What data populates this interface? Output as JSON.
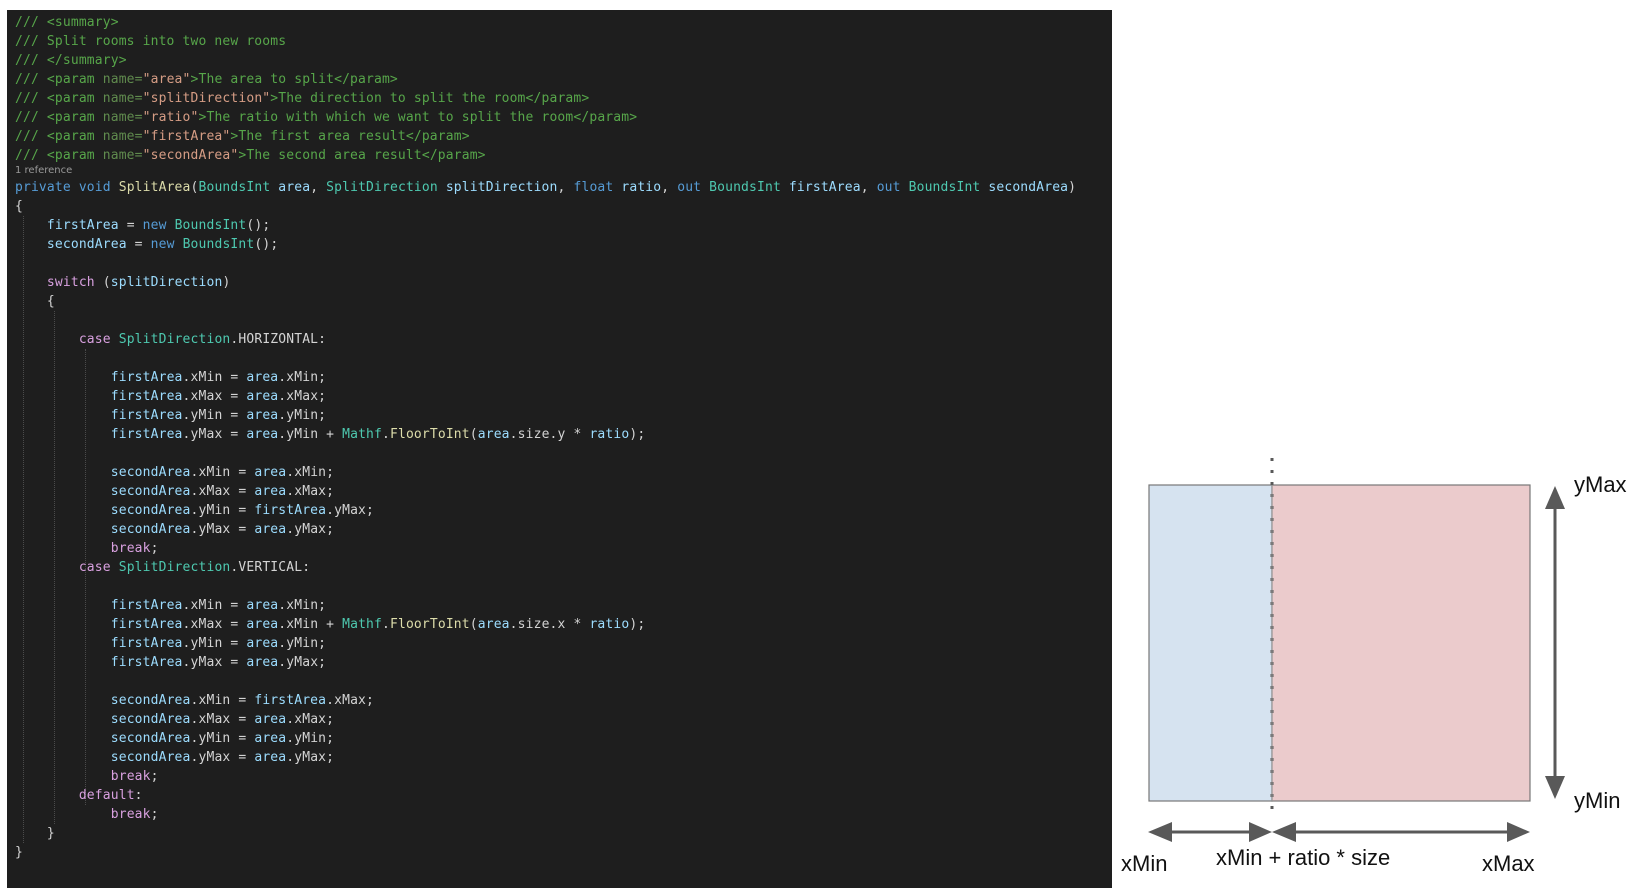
{
  "colors": {
    "editor_bg": "#1e1e1e",
    "comment": "#57a64a",
    "doc_tag": "#608b4e",
    "doc_string": "#d69d85",
    "keyword": "#569cd6",
    "control_keyword": "#d8a0df",
    "type": "#4ec9b0",
    "method": "#dcdcaa",
    "variable": "#9cdcfe",
    "parameter": "#9cdcfe",
    "plain": "#d4d4d4",
    "codelens": "#999999",
    "first_area_fill": "#d6e3f0",
    "second_area_fill": "#ebcbcc",
    "arrow": "#595959"
  },
  "code": {
    "reference_codelens": "1 reference",
    "lines": [
      [
        [
          "/// <summary>",
          "comment"
        ]
      ],
      [
        [
          "/// Split rooms into two new rooms",
          "comment"
        ]
      ],
      [
        [
          "/// </summary>",
          "comment"
        ]
      ],
      [
        [
          "/// <param ",
          "comment"
        ],
        [
          "name=",
          "doc_tag"
        ],
        [
          "\"area\"",
          "doc_string"
        ],
        [
          ">The area to split</param>",
          "comment"
        ]
      ],
      [
        [
          "/// <param ",
          "comment"
        ],
        [
          "name=",
          "doc_tag"
        ],
        [
          "\"splitDirection\"",
          "doc_string"
        ],
        [
          ">The direction to split the room</param>",
          "comment"
        ]
      ],
      [
        [
          "/// <param ",
          "comment"
        ],
        [
          "name=",
          "doc_tag"
        ],
        [
          "\"ratio\"",
          "doc_string"
        ],
        [
          ">The ratio with which we want to split the room</param>",
          "comment"
        ]
      ],
      [
        [
          "/// <param ",
          "comment"
        ],
        [
          "name=",
          "doc_tag"
        ],
        [
          "\"firstArea\"",
          "doc_string"
        ],
        [
          ">The first area result</param>",
          "comment"
        ]
      ],
      [
        [
          "/// <param ",
          "comment"
        ],
        [
          "name=",
          "doc_tag"
        ],
        [
          "\"secondArea\"",
          "doc_string"
        ],
        [
          ">The second area result</param>",
          "comment"
        ]
      ],
      [
        [
          "private ",
          "keyword"
        ],
        [
          "void ",
          "keyword"
        ],
        [
          "SplitArea",
          "method"
        ],
        [
          "(",
          "plain"
        ],
        [
          "BoundsInt ",
          "type"
        ],
        [
          "area",
          "parameter"
        ],
        [
          ", ",
          "plain"
        ],
        [
          "SplitDirection ",
          "type"
        ],
        [
          "splitDirection",
          "parameter"
        ],
        [
          ", ",
          "plain"
        ],
        [
          "float ",
          "keyword"
        ],
        [
          "ratio",
          "parameter"
        ],
        [
          ", ",
          "plain"
        ],
        [
          "out ",
          "keyword"
        ],
        [
          "BoundsInt ",
          "type"
        ],
        [
          "firstArea",
          "parameter"
        ],
        [
          ", ",
          "plain"
        ],
        [
          "out ",
          "keyword"
        ],
        [
          "BoundsInt ",
          "type"
        ],
        [
          "secondArea",
          "parameter"
        ],
        [
          ")",
          "plain"
        ]
      ],
      [
        [
          "{",
          "plain"
        ]
      ],
      [
        [
          "    ",
          "plain"
        ],
        [
          "firstArea",
          "variable"
        ],
        [
          " = ",
          "plain"
        ],
        [
          "new ",
          "keyword"
        ],
        [
          "BoundsInt",
          "type"
        ],
        [
          "();",
          "plain"
        ]
      ],
      [
        [
          "    ",
          "plain"
        ],
        [
          "secondArea",
          "variable"
        ],
        [
          " = ",
          "plain"
        ],
        [
          "new ",
          "keyword"
        ],
        [
          "BoundsInt",
          "type"
        ],
        [
          "();",
          "plain"
        ]
      ],
      [],
      [
        [
          "    ",
          "plain"
        ],
        [
          "switch ",
          "control_keyword"
        ],
        [
          "(",
          "plain"
        ],
        [
          "splitDirection",
          "variable"
        ],
        [
          ")",
          "plain"
        ]
      ],
      [
        [
          "    {",
          "plain"
        ]
      ],
      [],
      [
        [
          "        ",
          "plain"
        ],
        [
          "case ",
          "control_keyword"
        ],
        [
          "SplitDirection",
          "type"
        ],
        [
          ".HORIZONTAL:",
          "plain"
        ]
      ],
      [],
      [
        [
          "            ",
          "plain"
        ],
        [
          "firstArea",
          "variable"
        ],
        [
          ".xMin = ",
          "plain"
        ],
        [
          "area",
          "variable"
        ],
        [
          ".xMin;",
          "plain"
        ]
      ],
      [
        [
          "            ",
          "plain"
        ],
        [
          "firstArea",
          "variable"
        ],
        [
          ".xMax = ",
          "plain"
        ],
        [
          "area",
          "variable"
        ],
        [
          ".xMax;",
          "plain"
        ]
      ],
      [
        [
          "            ",
          "plain"
        ],
        [
          "firstArea",
          "variable"
        ],
        [
          ".yMin = ",
          "plain"
        ],
        [
          "area",
          "variable"
        ],
        [
          ".yMin;",
          "plain"
        ]
      ],
      [
        [
          "            ",
          "plain"
        ],
        [
          "firstArea",
          "variable"
        ],
        [
          ".yMax = ",
          "plain"
        ],
        [
          "area",
          "variable"
        ],
        [
          ".yMin + ",
          "plain"
        ],
        [
          "Mathf",
          "type"
        ],
        [
          ".",
          "plain"
        ],
        [
          "FloorToInt",
          "method"
        ],
        [
          "(",
          "plain"
        ],
        [
          "area",
          "variable"
        ],
        [
          ".size.y * ",
          "plain"
        ],
        [
          "ratio",
          "variable"
        ],
        [
          ");",
          "plain"
        ]
      ],
      [],
      [
        [
          "            ",
          "plain"
        ],
        [
          "secondArea",
          "variable"
        ],
        [
          ".xMin = ",
          "plain"
        ],
        [
          "area",
          "variable"
        ],
        [
          ".xMin;",
          "plain"
        ]
      ],
      [
        [
          "            ",
          "plain"
        ],
        [
          "secondArea",
          "variable"
        ],
        [
          ".xMax = ",
          "plain"
        ],
        [
          "area",
          "variable"
        ],
        [
          ".xMax;",
          "plain"
        ]
      ],
      [
        [
          "            ",
          "plain"
        ],
        [
          "secondArea",
          "variable"
        ],
        [
          ".yMin = ",
          "plain"
        ],
        [
          "firstArea",
          "variable"
        ],
        [
          ".yMax;",
          "plain"
        ]
      ],
      [
        [
          "            ",
          "plain"
        ],
        [
          "secondArea",
          "variable"
        ],
        [
          ".yMax = ",
          "plain"
        ],
        [
          "area",
          "variable"
        ],
        [
          ".yMax;",
          "plain"
        ]
      ],
      [
        [
          "            ",
          "plain"
        ],
        [
          "break",
          "control_keyword"
        ],
        [
          ";",
          "plain"
        ]
      ],
      [
        [
          "        ",
          "plain"
        ],
        [
          "case ",
          "control_keyword"
        ],
        [
          "SplitDirection",
          "type"
        ],
        [
          ".VERTICAL:",
          "plain"
        ]
      ],
      [],
      [
        [
          "            ",
          "plain"
        ],
        [
          "firstArea",
          "variable"
        ],
        [
          ".xMin = ",
          "plain"
        ],
        [
          "area",
          "variable"
        ],
        [
          ".xMin;",
          "plain"
        ]
      ],
      [
        [
          "            ",
          "plain"
        ],
        [
          "firstArea",
          "variable"
        ],
        [
          ".xMax = ",
          "plain"
        ],
        [
          "area",
          "variable"
        ],
        [
          ".xMin + ",
          "plain"
        ],
        [
          "Mathf",
          "type"
        ],
        [
          ".",
          "plain"
        ],
        [
          "FloorToInt",
          "method"
        ],
        [
          "(",
          "plain"
        ],
        [
          "area",
          "variable"
        ],
        [
          ".size.x * ",
          "plain"
        ],
        [
          "ratio",
          "variable"
        ],
        [
          ");",
          "plain"
        ]
      ],
      [
        [
          "            ",
          "plain"
        ],
        [
          "firstArea",
          "variable"
        ],
        [
          ".yMin = ",
          "plain"
        ],
        [
          "area",
          "variable"
        ],
        [
          ".yMin;",
          "plain"
        ]
      ],
      [
        [
          "            ",
          "plain"
        ],
        [
          "firstArea",
          "variable"
        ],
        [
          ".yMax = ",
          "plain"
        ],
        [
          "area",
          "variable"
        ],
        [
          ".yMax;",
          "plain"
        ]
      ],
      [],
      [
        [
          "            ",
          "plain"
        ],
        [
          "secondArea",
          "variable"
        ],
        [
          ".xMin = ",
          "plain"
        ],
        [
          "firstArea",
          "variable"
        ],
        [
          ".xMax;",
          "plain"
        ]
      ],
      [
        [
          "            ",
          "plain"
        ],
        [
          "secondArea",
          "variable"
        ],
        [
          ".xMax = ",
          "plain"
        ],
        [
          "area",
          "variable"
        ],
        [
          ".xMax;",
          "plain"
        ]
      ],
      [
        [
          "            ",
          "plain"
        ],
        [
          "secondArea",
          "variable"
        ],
        [
          ".yMin = ",
          "plain"
        ],
        [
          "area",
          "variable"
        ],
        [
          ".yMin;",
          "plain"
        ]
      ],
      [
        [
          "            ",
          "plain"
        ],
        [
          "secondArea",
          "variable"
        ],
        [
          ".yMax = ",
          "plain"
        ],
        [
          "area",
          "variable"
        ],
        [
          ".yMax;",
          "plain"
        ]
      ],
      [
        [
          "            ",
          "plain"
        ],
        [
          "break",
          "control_keyword"
        ],
        [
          ";",
          "plain"
        ]
      ],
      [
        [
          "        ",
          "plain"
        ],
        [
          "default",
          "control_keyword"
        ],
        [
          ":",
          "plain"
        ]
      ],
      [
        [
          "            ",
          "plain"
        ],
        [
          "break",
          "control_keyword"
        ],
        [
          ";",
          "plain"
        ]
      ],
      [
        [
          "    }",
          "plain"
        ]
      ],
      [
        [
          "}",
          "plain"
        ]
      ]
    ]
  },
  "diagram": {
    "labels": {
      "y_max": "yMax",
      "y_min": "yMin",
      "x_min": "xMin",
      "split": "xMin + ratio * size",
      "x_max": "xMax"
    }
  }
}
